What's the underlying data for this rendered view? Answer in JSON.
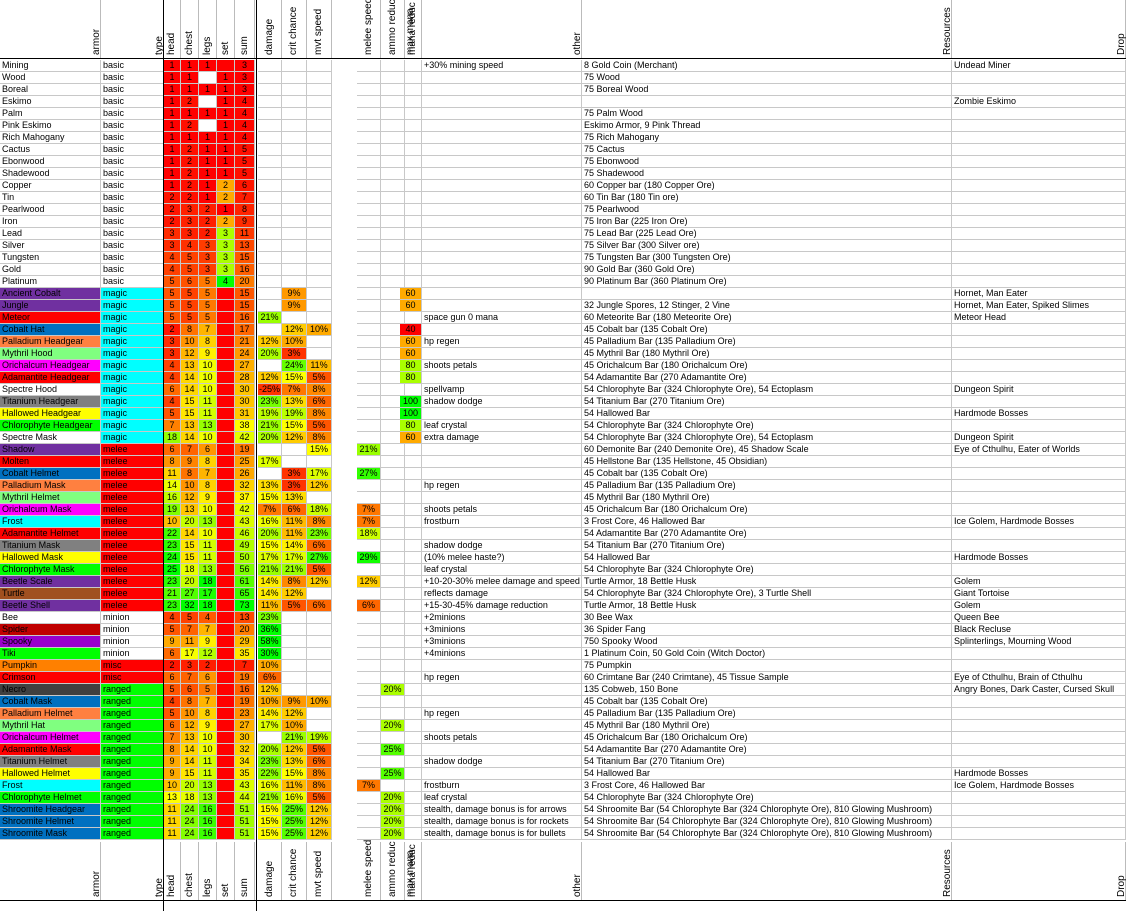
{
  "headers": {
    "armor": "armor",
    "type": "type",
    "head": "head",
    "chest": "chest",
    "legs": "legs",
    "set": "set",
    "sum": "sum",
    "damage": "damage",
    "crit": "crit chance",
    "mvt": "mvt speed",
    "melee": "melee speed",
    "ammo": "ammo reduc",
    "manar": "mana reduc",
    "maxmana": "max mana",
    "other": "other",
    "resources": "Resources",
    "drop": "Drop"
  },
  "rows": [
    [
      "Mining",
      "basic",
      "1",
      "1",
      "1",
      "",
      "3",
      "",
      "",
      "",
      "",
      "",
      "",
      "",
      "+30% mining speed",
      "8 Gold Coin (Merchant)",
      "Undead Miner"
    ],
    [
      "Wood",
      "basic",
      "1",
      "1",
      "",
      "1",
      "3",
      "",
      "",
      "",
      "",
      "",
      "",
      "",
      "",
      "75 Wood",
      ""
    ],
    [
      "Boreal",
      "basic",
      "1",
      "1",
      "1",
      "1",
      "3",
      "",
      "",
      "",
      "",
      "",
      "",
      "",
      "",
      "75 Boreal Wood",
      ""
    ],
    [
      "Eskimo",
      "basic",
      "1",
      "2",
      "",
      "1",
      "4",
      "",
      "",
      "",
      "",
      "",
      "",
      "",
      "",
      "",
      "Zombie Eskimo"
    ],
    [
      "Palm",
      "basic",
      "1",
      "1",
      "1",
      "1",
      "4",
      "",
      "",
      "",
      "",
      "",
      "",
      "",
      "",
      "75 Palm Wood",
      ""
    ],
    [
      "Pink Eskimo",
      "basic",
      "1",
      "2",
      "",
      "1",
      "4",
      "",
      "",
      "",
      "",
      "",
      "",
      "",
      "",
      "Eskimo Armor, 9 Pink Thread",
      ""
    ],
    [
      "Rich Mahogany",
      "basic",
      "1",
      "1",
      "1",
      "1",
      "4",
      "",
      "",
      "",
      "",
      "",
      "",
      "",
      "",
      "75 Rich Mahogany",
      ""
    ],
    [
      "Cactus",
      "basic",
      "1",
      "2",
      "1",
      "1",
      "5",
      "",
      "",
      "",
      "",
      "",
      "",
      "",
      "",
      "75 Cactus",
      ""
    ],
    [
      "Ebonwood",
      "basic",
      "1",
      "2",
      "1",
      "1",
      "5",
      "",
      "",
      "",
      "",
      "",
      "",
      "",
      "",
      "75 Ebonwood",
      ""
    ],
    [
      "Shadewood",
      "basic",
      "1",
      "2",
      "1",
      "1",
      "5",
      "",
      "",
      "",
      "",
      "",
      "",
      "",
      "",
      "75 Shadewood",
      ""
    ],
    [
      "Copper",
      "basic",
      "1",
      "2",
      "1",
      "2",
      "6",
      "",
      "",
      "",
      "",
      "",
      "",
      "",
      "",
      "60 Copper bar (180 Copper Ore)",
      ""
    ],
    [
      "Tin",
      "basic",
      "2",
      "2",
      "1",
      "2",
      "7",
      "",
      "",
      "",
      "",
      "",
      "",
      "",
      "",
      "60 Tin Bar (180 Tin ore)",
      ""
    ],
    [
      "Pearlwood",
      "basic",
      "2",
      "3",
      "2",
      "1",
      "8",
      "",
      "",
      "",
      "",
      "",
      "",
      "",
      "",
      "75 Pearlwood",
      ""
    ],
    [
      "Iron",
      "basic",
      "2",
      "3",
      "2",
      "2",
      "9",
      "",
      "",
      "",
      "",
      "",
      "",
      "",
      "",
      "75 Iron Bar (225 Iron Ore)",
      ""
    ],
    [
      "Lead",
      "basic",
      "3",
      "3",
      "2",
      "3",
      "11",
      "",
      "",
      "",
      "",
      "",
      "",
      "",
      "",
      "75 Lead Bar (225 Lead Ore)",
      ""
    ],
    [
      "Silver",
      "basic",
      "3",
      "4",
      "3",
      "3",
      "13",
      "",
      "",
      "",
      "",
      "",
      "",
      "",
      "",
      "75 Silver Bar (300 Silver ore)",
      ""
    ],
    [
      "Tungsten",
      "basic",
      "4",
      "5",
      "3",
      "3",
      "15",
      "",
      "",
      "",
      "",
      "",
      "",
      "",
      "",
      "75 Tungsten Bar (300 Tungsten Ore)",
      ""
    ],
    [
      "Gold",
      "basic",
      "4",
      "5",
      "3",
      "3",
      "16",
      "",
      "",
      "",
      "",
      "",
      "",
      "",
      "",
      "90 Gold Bar (360 Gold Ore)",
      ""
    ],
    [
      "Platinum",
      "basic",
      "5",
      "6",
      "5",
      "4",
      "20",
      "",
      "",
      "",
      "",
      "",
      "",
      "",
      "",
      "90 Platinum Bar (360 Platinum Ore)",
      ""
    ],
    [
      "Ancient Cobalt",
      "magic",
      "5",
      "5",
      "5",
      "",
      "15",
      "",
      "9%",
      "",
      "",
      "",
      "16%",
      "60",
      "",
      "",
      "Hornet, Man Eater"
    ],
    [
      "Jungle",
      "magic",
      "5",
      "5",
      "5",
      "",
      "15",
      "",
      "9%",
      "",
      "",
      "",
      "16%",
      "60",
      "",
      "32 Jungle Spores, 12 Stinger, 2 Vine",
      "Hornet, Man Eater, Spiked Slimes"
    ],
    [
      "Meteor",
      "magic",
      "5",
      "5",
      "5",
      "",
      "16",
      "21%",
      "",
      "",
      "",
      "",
      "",
      "",
      "space gun 0 mana",
      "60 Meteorite Bar (180 Meteorite Ore)",
      "Meteor Head"
    ],
    [
      "Cobalt Hat",
      "magic",
      "2",
      "8",
      "7",
      "",
      "17",
      "",
      "12%",
      "10%",
      "",
      "",
      "14%",
      "40",
      "",
      "45 Cobalt bar (135 Cobalt Ore)",
      ""
    ],
    [
      "Palladium Headgear",
      "magic",
      "3",
      "10",
      "8",
      "",
      "21",
      "12%",
      "10%",
      "",
      "",
      "",
      "",
      "60",
      "hp regen",
      "45 Palladium Bar (135 Palladium Ore)",
      ""
    ],
    [
      "Mythril Hood",
      "magic",
      "3",
      "12",
      "9",
      "",
      "24",
      "20%",
      "3%",
      "",
      "",
      "",
      "17%",
      "60",
      "",
      "45 Mythril Bar (180 Mythril Ore)",
      ""
    ],
    [
      "Orichalcum Headgear",
      "magic",
      "4",
      "13",
      "10",
      "",
      "27",
      "",
      "24%",
      "11%",
      "",
      "",
      "",
      "80",
      "shoots petals",
      "45 Orichalcum Bar (180 Orichalcum Ore)",
      ""
    ],
    [
      "Adamantite Headgear",
      "magic",
      "4",
      "14",
      "10",
      "",
      "28",
      "12%",
      "15%",
      "5%",
      "",
      "",
      "19%",
      "80",
      "",
      "54 Adamantite Bar (270 Adamantite Ore)",
      ""
    ],
    [
      "Spectre Hood",
      "magic",
      "6",
      "14",
      "10",
      "",
      "30",
      "-25%",
      "7%",
      "8%",
      "",
      "",
      "",
      "",
      "spellvamp",
      "54 Chlorophyte Bar (324 Chlorophyte Ore), 54 Ectoplasm",
      "Dungeon Spirit"
    ],
    [
      "Titanium Headgear",
      "magic",
      "4",
      "15",
      "11",
      "",
      "30",
      "23%",
      "13%",
      "6%",
      "",
      "",
      "",
      "100",
      "shadow dodge",
      "54 Titanium Bar (270 Titanium Ore)",
      ""
    ],
    [
      "Hallowed Headgear",
      "magic",
      "5",
      "15",
      "11",
      "",
      "31",
      "19%",
      "19%",
      "8%",
      "",
      "",
      "20%",
      "100",
      "",
      "54 Hallowed Bar",
      "Hardmode Bosses"
    ],
    [
      "Chlorophyte Headgear",
      "magic",
      "7",
      "13",
      "13",
      "",
      "38",
      "21%",
      "15%",
      "5%",
      "",
      "",
      "17%",
      "80",
      "leaf crystal",
      "54 Chlorophyte Bar (324 Chlorophyte Ore)",
      ""
    ],
    [
      "Spectre Mask",
      "magic",
      "18",
      "14",
      "10",
      "",
      "42",
      "20%",
      "12%",
      "8%",
      "",
      "",
      "13%",
      "60",
      "extra damage",
      "54 Chlorophyte Bar (324 Chlorophyte Ore), 54 Ectoplasm",
      "Dungeon Spirit"
    ],
    [
      "Shadow",
      "melee",
      "6",
      "7",
      "6",
      "",
      "19",
      "",
      "",
      "15%",
      "21%",
      "",
      "",
      "",
      "",
      "60 Demonite Bar (240 Demonite Ore), 45 Shadow Scale",
      "Eye of Cthulhu, Eater of Worlds"
    ],
    [
      "Molten",
      "melee",
      "8",
      "9",
      "8",
      "",
      "25",
      "17%",
      "",
      "",
      "",
      "",
      "",
      "",
      "",
      "45 Hellstone Bar (135 Hellstone, 45 Obsidian)",
      ""
    ],
    [
      "Cobalt Helmet",
      "melee",
      "11",
      "8",
      "7",
      "",
      "26",
      "",
      "3%",
      "17%",
      "27%",
      "",
      "",
      "",
      "",
      "45 Cobalt bar (135 Cobalt Ore)",
      ""
    ],
    [
      "Palladium Mask",
      "melee",
      "14",
      "10",
      "8",
      "",
      "32",
      "13%",
      "3%",
      "12%",
      "",
      "",
      "",
      "",
      "hp regen",
      "45 Palladium Bar (135 Palladium Ore)",
      ""
    ],
    [
      "Mythril Helmet",
      "melee",
      "16",
      "12",
      "9",
      "",
      "37",
      "15%",
      "13%",
      "",
      "",
      "",
      "",
      "",
      "",
      "45 Mythril Bar (180 Mythril Ore)",
      ""
    ],
    [
      "Orichalcum Mask",
      "melee",
      "19",
      "13",
      "10",
      "",
      "42",
      "7%",
      "6%",
      "18%",
      "7%",
      "",
      "",
      "",
      "shoots petals",
      "45 Orichalcum Bar (180 Orichalcum Ore)",
      ""
    ],
    [
      "Frost",
      "melee",
      "10",
      "20",
      "13",
      "",
      "43",
      "16%",
      "11%",
      "8%",
      "7%",
      "",
      "",
      "",
      "frostburn",
      "3 Frost Core, 46 Hallowed Bar",
      "Ice Golem, Hardmode Bosses"
    ],
    [
      "Adamantite Helmet",
      "melee",
      "22",
      "14",
      "10",
      "",
      "46",
      "20%",
      "11%",
      "23%",
      "18%",
      "",
      "",
      "",
      "",
      "54 Adamantite Bar (270 Adamantite Ore)",
      ""
    ],
    [
      "Titanium Mask",
      "melee",
      "23",
      "15",
      "11",
      "",
      "49",
      "15%",
      "14%",
      "6%",
      "",
      "",
      "",
      "",
      "shadow dodge",
      "54 Titanium Bar (270 Titanium Ore)",
      ""
    ],
    [
      "Hallowed Mask",
      "melee",
      "24",
      "15",
      "11",
      "",
      "50",
      "17%",
      "17%",
      "27%",
      "29%",
      "",
      "",
      "",
      "(10% melee haste?)",
      "54 Hallowed Bar",
      "Hardmode Bosses"
    ],
    [
      "Chlorophyte Mask",
      "melee",
      "25",
      "18",
      "13",
      "",
      "56",
      "21%",
      "21%",
      "5%",
      "",
      "",
      "",
      "",
      "leaf crystal",
      "54 Chlorophyte Bar (324 Chlorophyte Ore)",
      ""
    ],
    [
      "Beetle Scale",
      "melee",
      "23",
      "20",
      "18",
      "",
      "61",
      "14%",
      "8%",
      "12%",
      "12%",
      "",
      "",
      "",
      "+10-20-30% melee damage and speed",
      "Turtle Armor, 18 Bettle Husk",
      "Golem"
    ],
    [
      "Turtle",
      "melee",
      "21",
      "27",
      "17",
      "",
      "65",
      "14%",
      "12%",
      "",
      "",
      "",
      "",
      "",
      "reflects damage",
      "54 Chlorophyte Bar (324 Chlorophyte Ore), 3 Turtle Shell",
      "Giant Tortoise"
    ],
    [
      "Beetle Shell",
      "melee",
      "23",
      "32",
      "18",
      "",
      "73",
      "11%",
      "5%",
      "6%",
      "6%",
      "",
      "",
      "",
      "+15-30-45% damage reduction",
      "Turtle Armor, 18 Bettle Husk",
      "Golem"
    ],
    [
      "Bee",
      "minion",
      "4",
      "5",
      "4",
      "",
      "13",
      "23%",
      "",
      "",
      "",
      "",
      "",
      "",
      "+2minions",
      "30 Bee Wax",
      "Queen Bee"
    ],
    [
      "Spider",
      "minion",
      "5",
      "7",
      "7",
      "",
      "20",
      "36%",
      "",
      "",
      "",
      "",
      "",
      "",
      "+3minions",
      "36 Spider Fang",
      "Black Recluse"
    ],
    [
      "Spooky",
      "minion",
      "9",
      "11",
      "9",
      "",
      "29",
      "58%",
      "",
      "",
      "",
      "",
      "",
      "",
      "+3minions",
      "750 Spooky Wood",
      "Splinterlings, Mourning Wood"
    ],
    [
      "Tiki",
      "minion",
      "6",
      "17",
      "12",
      "",
      "35",
      "30%",
      "",
      "",
      "",
      "",
      "",
      "",
      "+4minions",
      "1 Platinum Coin, 50 Gold Coin (Witch Doctor)",
      ""
    ],
    [
      "Pumpkin",
      "misc",
      "2",
      "3",
      "2",
      "",
      "7",
      "10%",
      "",
      "",
      "",
      "",
      "",
      "",
      "",
      "75 Pumpkin",
      ""
    ],
    [
      "Crimson",
      "misc",
      "6",
      "7",
      "6",
      "",
      "19",
      "6%",
      "",
      "",
      "",
      "",
      "",
      "",
      "hp regen",
      "60 Crimtane Bar (240 Crimtane), 45 Tissue Sample",
      "Eye of Cthulhu, Brain of Cthulhu"
    ],
    [
      "Necro",
      "ranged",
      "5",
      "6",
      "5",
      "",
      "16",
      "12%",
      "",
      "",
      "",
      "20%",
      "",
      "",
      "",
      "135 Cobweb, 150 Bone",
      "Angry Bones, Dark Caster, Cursed Skull"
    ],
    [
      "Cobalt Mask",
      "ranged",
      "4",
      "8",
      "7",
      "",
      "19",
      "10%",
      "9%",
      "10%",
      "",
      "",
      "",
      "",
      "",
      "45 Cobalt bar (135 Cobalt Ore)",
      ""
    ],
    [
      "Palladium Helmet",
      "ranged",
      "5",
      "10",
      "8",
      "",
      "23",
      "14%",
      "12%",
      "",
      "",
      "",
      "",
      "",
      "hp regen",
      "45 Palladium Bar (135 Palladium Ore)",
      ""
    ],
    [
      "Mythril Hat",
      "ranged",
      "6",
      "12",
      "9",
      "",
      "27",
      "17%",
      "10%",
      "",
      "",
      "20%",
      "",
      "",
      "",
      "45 Mythril Bar (180 Mythril Ore)",
      ""
    ],
    [
      "Orichalcum Helmet",
      "ranged",
      "7",
      "13",
      "10",
      "",
      "30",
      "",
      "21%",
      "19%",
      "",
      "",
      "",
      "",
      "shoots petals",
      "45 Orichalcum Bar (180 Orichalcum Ore)",
      ""
    ],
    [
      "Adamantite Mask",
      "ranged",
      "8",
      "14",
      "10",
      "",
      "32",
      "20%",
      "12%",
      "5%",
      "",
      "25%",
      "",
      "",
      "",
      "54 Adamantite Bar (270 Adamantite Ore)",
      ""
    ],
    [
      "Titanium Helmet",
      "ranged",
      "9",
      "14",
      "11",
      "",
      "34",
      "23%",
      "13%",
      "6%",
      "",
      "",
      "",
      "",
      "shadow dodge",
      "54 Titanium Bar (270 Titanium Ore)",
      ""
    ],
    [
      "Hallowed Helmet",
      "ranged",
      "9",
      "15",
      "11",
      "",
      "35",
      "22%",
      "15%",
      "8%",
      "",
      "25%",
      "",
      "",
      "",
      "54 Hallowed Bar",
      "Hardmode Bosses"
    ],
    [
      "Frost",
      "ranged",
      "10",
      "20",
      "13",
      "",
      "43",
      "16%",
      "11%",
      "8%",
      "7%",
      "",
      "",
      "",
      "frostburn",
      "3 Frost Core, 46 Hallowed Bar",
      "Ice Golem, Hardmode Bosses"
    ],
    [
      "Chlorophyte Helmet",
      "ranged",
      "13",
      "18",
      "13",
      "",
      "44",
      "21%",
      "16%",
      "5%",
      "",
      "20%",
      "",
      "",
      "leaf crystal",
      "54 Chlorophyte Bar (324 Chlorophyte Ore)",
      ""
    ],
    [
      "Shroomite Headgear",
      "ranged",
      "11",
      "24",
      "16",
      "",
      "51",
      "15%",
      "25%",
      "12%",
      "",
      "20%",
      "",
      "",
      "stealth, damage bonus is for arrows",
      "54 Shroomite Bar (54 Chlorophyte Bar (324 Chlorophyte Ore), 810 Glowing Mushroom)",
      ""
    ],
    [
      "Shroomite Helmet",
      "ranged",
      "11",
      "24",
      "16",
      "",
      "51",
      "15%",
      "25%",
      "12%",
      "",
      "20%",
      "",
      "",
      "stealth, damage bonus is for rockets",
      "54 Shroomite Bar (54 Chlorophyte Bar (324 Chlorophyte Ore), 810 Glowing Mushroom)",
      ""
    ],
    [
      "Shroomite Mask",
      "ranged",
      "11",
      "24",
      "16",
      "",
      "51",
      "15%",
      "25%",
      "12%",
      "",
      "20%",
      "",
      "",
      "stealth, damage bonus is for bullets",
      "54 Shroomite Bar (54 Chlorophyte Bar (324 Chlorophyte Ore), 810 Glowing Mushroom)",
      ""
    ]
  ],
  "colors": {
    "magic_type": "#00ffff",
    "melee_type": "#ff0000",
    "minion_type": "#ffffff",
    "misc_type": "#ff0000",
    "ranged_type": "#00ff00",
    "scale_low": "#ff0000",
    "scale_mid": "#ffff00",
    "scale_high": "#00ff00"
  },
  "armor_colors": {
    "Ancient Cobalt": "#7030a0",
    "Jungle": "#7030a0",
    "Meteor": "#ff0000",
    "Cobalt Hat": "#0070c0",
    "Palladium Headgear": "#ff8040",
    "Mythril Hood": "#80ff80",
    "Orichalcum Headgear": "#ff00ff",
    "Adamantite Headgear": "#ff0000",
    "Titanium Headgear": "#808080",
    "Hallowed Headgear": "#ffff00",
    "Chlorophyte Headgear": "#00ff00",
    "Shadow": "#7030a0",
    "Molten": "#ff0000",
    "Cobalt Helmet": "#0070c0",
    "Palladium Mask": "#ff8040",
    "Mythril Helmet": "#80ff80",
    "Orichalcum Mask": "#ff00ff",
    "Frost": "#00ffff",
    "Adamantite Helmet": "#ff0000",
    "Titanium Mask": "#808080",
    "Hallowed Mask": "#ffff00",
    "Chlorophyte Mask": "#00ff00",
    "Beetle Scale": "#7030a0",
    "Turtle": "#a05020",
    "Beetle Shell": "#7030a0",
    "Spider": "#c00000",
    "Spooky": "#9900cc",
    "Tiki": "#00ff00",
    "Pumpkin": "#ff8000",
    "Crimson": "#ff0000",
    "Necro": "#404040",
    "Cobalt Mask": "#0070c0",
    "Palladium Helmet": "#ff8040",
    "Mythril Hat": "#80ff80",
    "Orichalcum Helmet": "#ff00ff",
    "Adamantite Mask": "#ff0000",
    "Titanium Helmet": "#808080",
    "Hallowed Helmet": "#ffff00",
    "Chlorophyte Helmet": "#00ff00",
    "Shroomite Headgear": "#0070c0",
    "Shroomite Helmet": "#0070c0",
    "Shroomite Mask": "#0070c0"
  }
}
